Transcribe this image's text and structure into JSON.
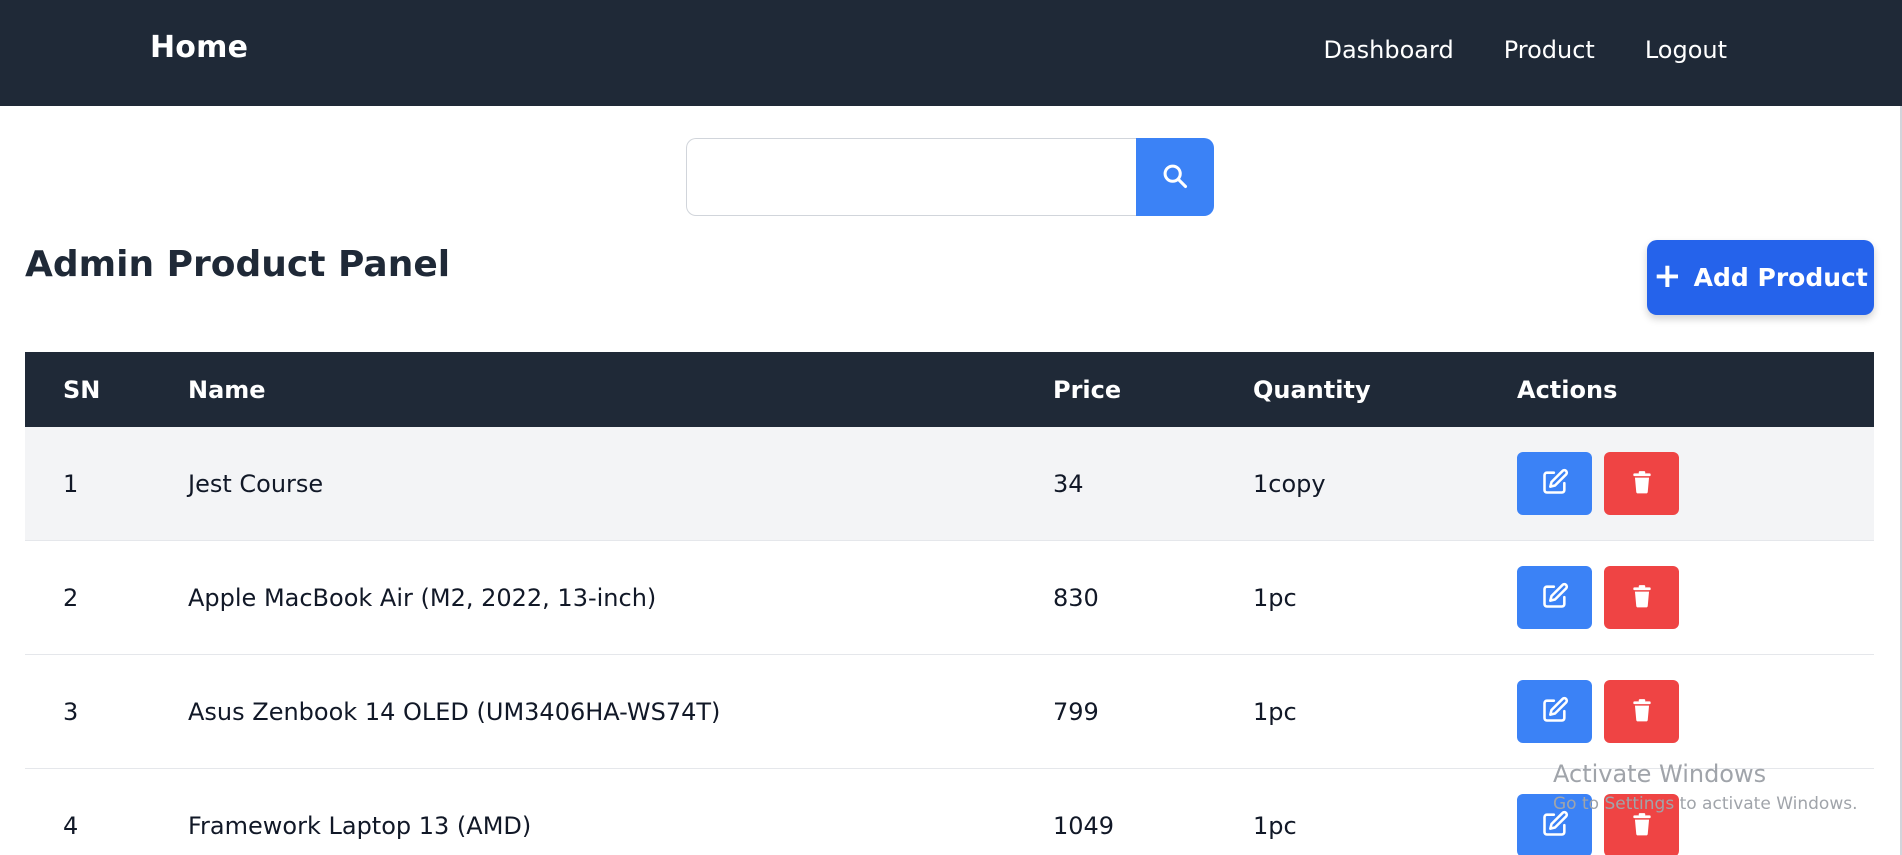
{
  "navbar": {
    "brand": "Home",
    "links": [
      "Dashboard",
      "Product",
      "Logout"
    ]
  },
  "search": {
    "value": "",
    "placeholder": "",
    "button_icon": "search-icon"
  },
  "panel": {
    "title": "Admin Product Panel",
    "add_label": "Add Product",
    "add_icon": "plus-icon"
  },
  "table": {
    "headers": [
      "SN",
      "Name",
      "Price",
      "Quantity",
      "Actions"
    ],
    "rows": [
      {
        "sn": "1",
        "name": "Jest Course",
        "price": "34",
        "quantity": "1copy"
      },
      {
        "sn": "2",
        "name": "Apple MacBook Air (M2, 2022, 13-inch)",
        "price": "830",
        "quantity": "1pc"
      },
      {
        "sn": "3",
        "name": "Asus Zenbook 14 OLED (UM3406HA-WS74T)",
        "price": "799",
        "quantity": "1pc"
      },
      {
        "sn": "4",
        "name": "Framework Laptop 13 (AMD)",
        "price": "1049",
        "quantity": "1pc"
      }
    ],
    "action_icons": [
      "edit-icon",
      "trash-icon"
    ]
  },
  "watermark": {
    "title": "Activate Windows",
    "subtitle": "Go to Settings to activate Windows."
  },
  "colors": {
    "navbar": "#1f2937",
    "primary": "#2563eb",
    "search_button": "#3b82f6",
    "edit": "#3b82f6",
    "delete": "#ef4444",
    "row_alt": "#f3f4f6"
  }
}
